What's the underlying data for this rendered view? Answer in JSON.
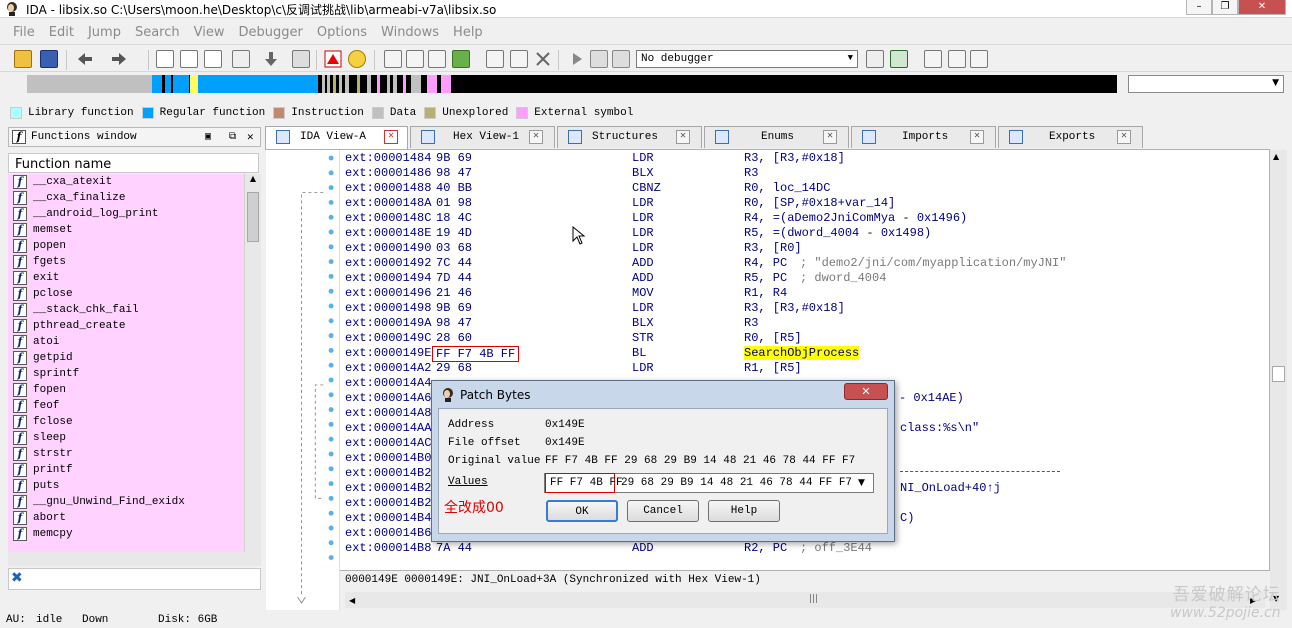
{
  "window": {
    "title": "IDA - libsix.so C:\\Users\\moon.he\\Desktop\\c\\反调试挑战\\lib\\armeabi-v7a\\libsix.so",
    "buttons": [
      "–",
      "❐",
      "✕"
    ]
  },
  "menu": [
    "File",
    "Edit",
    "Jump",
    "Search",
    "View",
    "Debugger",
    "Options",
    "Windows",
    "Help"
  ],
  "toolbar": {
    "debugger_select": "No debugger",
    "icons": [
      "open-file-icon",
      "save-icon",
      "back-arrow-icon",
      "forward-arrow-icon",
      "binary-search-icon",
      "text-search-icon",
      "code-icon",
      "data-icon",
      "unknown-icon",
      "run-icon",
      "pause-icon",
      "stop-icon"
    ]
  },
  "legend": [
    {
      "label": "Library function",
      "color": "#a8ffff"
    },
    {
      "label": "Regular function",
      "color": "#00a0ff"
    },
    {
      "label": "Instruction",
      "color": "#c08a70"
    },
    {
      "label": "Data",
      "color": "#c0c0c0"
    },
    {
      "label": "Unexplored",
      "color": "#b8b070"
    },
    {
      "label": "External symbol",
      "color": "#ff9cff"
    }
  ],
  "functions_window": {
    "title": "Functions window",
    "column": "Function name",
    "items": [
      "__cxa_atexit",
      "__cxa_finalize",
      "__android_log_print",
      "memset",
      "popen",
      "fgets",
      "exit",
      "pclose",
      "__stack_chk_fail",
      "pthread_create",
      "atoi",
      "getpid",
      "sprintf",
      "fopen",
      "feof",
      "fclose",
      "sleep",
      "strstr",
      "printf",
      "puts",
      "__gnu_Unwind_Find_exidx",
      "abort",
      "memcpy"
    ]
  },
  "tabs": [
    {
      "label": "IDA View-A",
      "active": true
    },
    {
      "label": "Hex View-1",
      "active": false
    },
    {
      "label": "Structures",
      "active": false
    },
    {
      "label": "Enums",
      "active": false
    },
    {
      "label": "Imports",
      "active": false
    },
    {
      "label": "Exports",
      "active": false
    }
  ],
  "disasm": [
    {
      "addr": "ext:00001484",
      "bytes": "9B 69",
      "mn": "LDR",
      "op": "R3, [R3,#0x18]",
      "cm": ""
    },
    {
      "addr": "ext:00001486",
      "bytes": "98 47",
      "mn": "BLX",
      "op": "R3",
      "cm": ""
    },
    {
      "addr": "ext:00001488",
      "bytes": "40 BB",
      "mn": "CBNZ",
      "op": "R0, loc_14DC",
      "cm": ""
    },
    {
      "addr": "ext:0000148A",
      "bytes": "01 98",
      "mn": "LDR",
      "op": "R0, [SP,#0x18+var_14]",
      "cm": ""
    },
    {
      "addr": "ext:0000148C",
      "bytes": "18 4C",
      "mn": "LDR",
      "op": "R4, =(aDemo2JniComMya - 0x1496)",
      "cm": ""
    },
    {
      "addr": "ext:0000148E",
      "bytes": "19 4D",
      "mn": "LDR",
      "op": "R5, =(dword_4004 - 0x1498)",
      "cm": ""
    },
    {
      "addr": "ext:00001490",
      "bytes": "03 68",
      "mn": "LDR",
      "op": "R3, [R0]",
      "cm": ""
    },
    {
      "addr": "ext:00001492",
      "bytes": "7C 44",
      "mn": "ADD",
      "op": "R4, PC",
      "cm": "; \"demo2/jni/com/myapplication/myJNI\""
    },
    {
      "addr": "ext:00001494",
      "bytes": "7D 44",
      "mn": "ADD",
      "op": "R5, PC",
      "cm": "; dword_4004"
    },
    {
      "addr": "ext:00001496",
      "bytes": "21 46",
      "mn": "MOV",
      "op": "R1, R4",
      "cm": ""
    },
    {
      "addr": "ext:00001498",
      "bytes": "9B 69",
      "mn": "LDR",
      "op": "R3, [R3,#0x18]",
      "cm": ""
    },
    {
      "addr": "ext:0000149A",
      "bytes": "98 47",
      "mn": "BLX",
      "op": "R3",
      "cm": ""
    },
    {
      "addr": "ext:0000149C",
      "bytes": "28 60",
      "mn": "STR",
      "op": "R0, [R5]",
      "cm": ""
    },
    {
      "addr": "ext:0000149E",
      "bytes": "FF F7 4B FF",
      "mn": "BL",
      "op": "SearchObjProcess",
      "cm": ""
    },
    {
      "addr": "ext:000014A2",
      "bytes": "29 68",
      "mn": "LDR",
      "op": "R1, [R5]",
      "cm": ""
    },
    {
      "addr": "ext:000014A4",
      "bytes": "",
      "mn": "",
      "op": "",
      "cm": ""
    },
    {
      "addr": "ext:000014A6",
      "bytes": "",
      "mn": "",
      "op": "- 0x14AE)",
      "cm": ""
    },
    {
      "addr": "ext:000014A8",
      "bytes": "",
      "mn": "",
      "op": "",
      "cm": ""
    },
    {
      "addr": "ext:000014AA",
      "bytes": "",
      "mn": "",
      "op": "class:%s\\n\"",
      "cm": ""
    },
    {
      "addr": "ext:000014AC",
      "bytes": "",
      "mn": "",
      "op": "",
      "cm": ""
    },
    {
      "addr": "ext:000014B0",
      "bytes": "",
      "mn": "",
      "op": "",
      "cm": ""
    },
    {
      "addr": "ext:000014B2",
      "bytes": "",
      "mn": "",
      "op": "",
      "cm": ""
    },
    {
      "addr": "ext:000014B2",
      "bytes": "",
      "mn": "",
      "op": "NI_OnLoad+40↑j",
      "cm": ""
    },
    {
      "addr": "ext:000014B2",
      "bytes": "",
      "mn": "",
      "op": "",
      "cm": ""
    },
    {
      "addr": "ext:000014B4",
      "bytes": "",
      "mn": "",
      "op": "C)",
      "cm": ""
    },
    {
      "addr": "ext:000014B6",
      "bytes": "03 68",
      "mn": "LDR",
      "op": "R3, [R0]",
      "cm": ""
    },
    {
      "addr": "ext:000014B8",
      "bytes": "7A 44",
      "mn": "ADD",
      "op": "R2, PC",
      "cm": "; off_3E44"
    }
  ],
  "sync_line": "0000149E 0000149E: JNI_OnLoad+3A (Synchronized with Hex View-1)",
  "patch_dialog": {
    "title": "Patch Bytes",
    "address_label": "Address",
    "address_value": "0x149E",
    "offset_label": "File offset",
    "offset_value": "0x149E",
    "original_label": "Original value",
    "original_value": "FF F7 4B FF 29 68 29 B9 14 48 21 46 78 44 FF F7",
    "values_label": "Values",
    "values_highlight": "FF F7 4B FF",
    "values_rest": "29 68 29 B9 14 48 21 46 78 44 FF F7",
    "annotation": "全改成00",
    "ok": "OK",
    "cancel": "Cancel",
    "help": "Help"
  },
  "status": {
    "au": "AU:",
    "state": "idle",
    "direction": "Down",
    "disk": "Disk: 6GB"
  },
  "watermark": {
    "line1": "吾爱破解论坛",
    "line2": "www.52pojie.cn"
  }
}
